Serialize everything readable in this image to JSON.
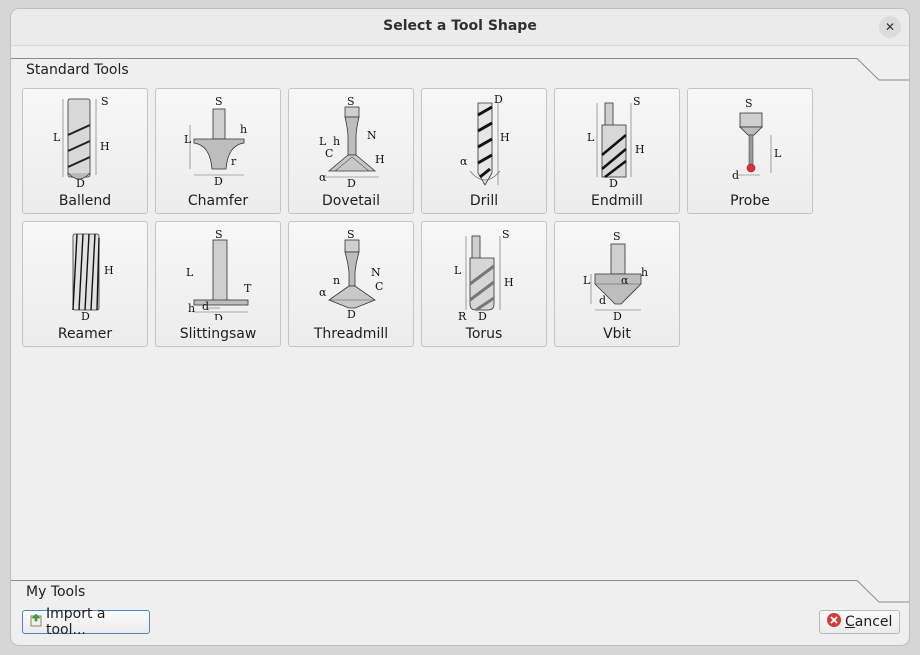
{
  "window": {
    "title": "Select a Tool Shape"
  },
  "sections": {
    "standard": "Standard Tools",
    "mine": "My Tools"
  },
  "tools": [
    {
      "label": "Ballend",
      "icon": "ballend-shape-icon"
    },
    {
      "label": "Chamfer",
      "icon": "chamfer-shape-icon"
    },
    {
      "label": "Dovetail",
      "icon": "dovetail-shape-icon"
    },
    {
      "label": "Drill",
      "icon": "drill-shape-icon"
    },
    {
      "label": "Endmill",
      "icon": "endmill-shape-icon"
    },
    {
      "label": "Probe",
      "icon": "probe-shape-icon"
    },
    {
      "label": "Reamer",
      "icon": "reamer-shape-icon"
    },
    {
      "label": "Slittingsaw",
      "icon": "slittingsaw-shape-icon"
    },
    {
      "label": "Threadmill",
      "icon": "threadmill-shape-icon"
    },
    {
      "label": "Torus",
      "icon": "torus-shape-icon"
    },
    {
      "label": "Vbit",
      "icon": "vbit-shape-icon"
    }
  ],
  "buttons": {
    "import": "Import a tool...",
    "cancel_mnemonic": "C",
    "cancel_rest": "ancel"
  },
  "colors": {
    "accent_focus": "#4a87c9",
    "cancel_icon": "#d23b3b",
    "probe_tip": "#e0303a"
  }
}
